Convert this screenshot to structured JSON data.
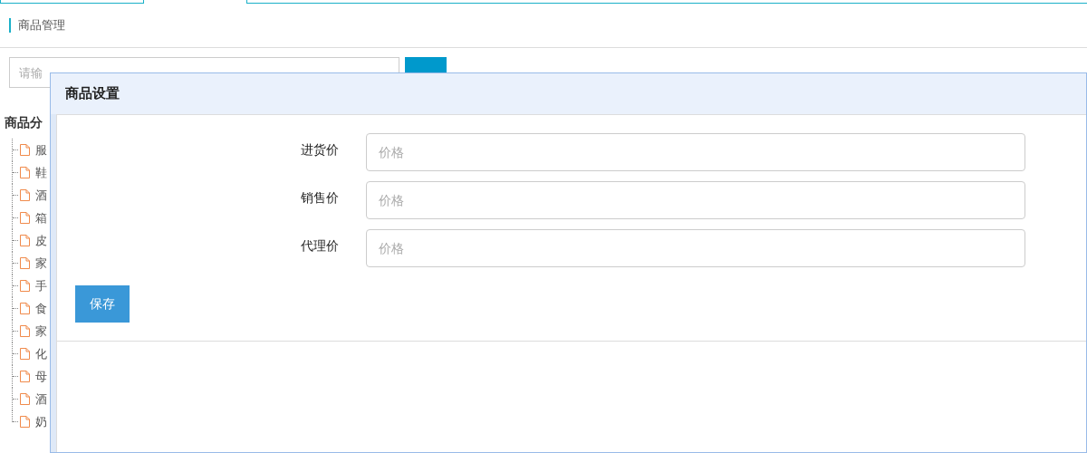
{
  "page": {
    "title": "商品管理"
  },
  "search": {
    "placeholder": "请输"
  },
  "category_tree": {
    "title": "商品分",
    "items": [
      {
        "label": "服"
      },
      {
        "label": "鞋"
      },
      {
        "label": "酒"
      },
      {
        "label": "箱"
      },
      {
        "label": "皮"
      },
      {
        "label": "家"
      },
      {
        "label": "手"
      },
      {
        "label": "食"
      },
      {
        "label": "家"
      },
      {
        "label": "化"
      },
      {
        "label": "母"
      },
      {
        "label": "酒"
      },
      {
        "label": "奶"
      }
    ]
  },
  "dialog": {
    "title": "商品设置",
    "fields": [
      {
        "label": "进货价",
        "placeholder": "价格"
      },
      {
        "label": "销售价",
        "placeholder": "价格"
      },
      {
        "label": "代理价",
        "placeholder": "价格"
      }
    ],
    "save_button": "保存"
  }
}
